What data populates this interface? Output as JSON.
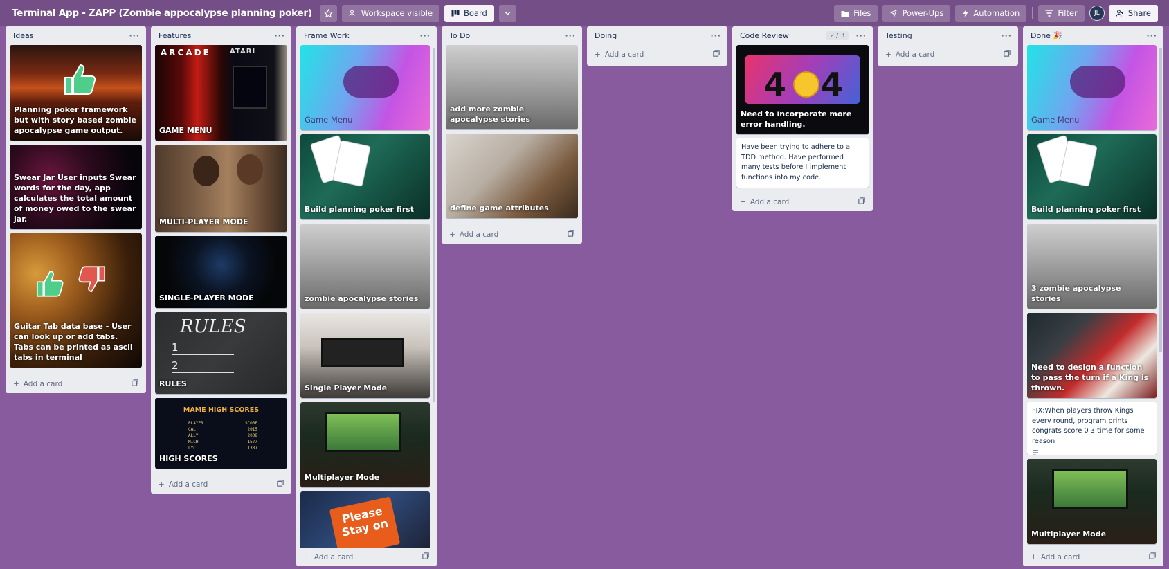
{
  "header": {
    "board_title": "Terminal App - ZAPP (Zombie appocalypse planning poker)",
    "workspace_visible": "Workspace visible",
    "board_label": "Board",
    "files": "Files",
    "powerups": "Power-Ups",
    "automation": "Automation",
    "filter": "Filter",
    "avatar_initials": "JL",
    "share": "Share"
  },
  "add_card": "Add a card",
  "lists": {
    "ideas": {
      "title": "Ideas",
      "cards": [
        "Planning poker framework but with story based zombie apocalypse game output.",
        "Swear Jar User inputs Swear words for the day, app calculates the total amount of money owed to the swear jar.",
        "Guitar Tab data base - User can look up or add tabs. Tabs can be printed as ascii tabs in terminal"
      ]
    },
    "features": {
      "title": "Features",
      "cards": [
        "GAME MENU",
        "MULTI-PLAYER MODE",
        "SINGLE-PLAYER MODE",
        "RULES",
        "HIGH SCORES"
      ],
      "art": {
        "arcade": "ARCADE",
        "atari": "ATARI",
        "rules_heading": "RULES",
        "rule1": "1",
        "rule2": "2",
        "mame": "MAME HIGH SCORES",
        "hs_cols": [
          "PLAYER",
          "SCORE"
        ],
        "hs_rows": [
          [
            "CAL",
            "2015"
          ],
          [
            "ALLY",
            "2008"
          ],
          [
            "MICH",
            "1577"
          ],
          [
            "LYC",
            "1337"
          ]
        ]
      }
    },
    "framework": {
      "title": "Frame Work",
      "cards": [
        "Game Menu",
        "Build planning poker first",
        "zombie apocalypse stories",
        "Single Player Mode",
        "Multiplayer Mode"
      ],
      "please_text": "Please Stay on"
    },
    "todo": {
      "title": "To Do",
      "cards": [
        "add more zombie apocalypse stories",
        "define game attributes"
      ]
    },
    "doing": {
      "title": "Doing"
    },
    "code_review": {
      "title": "Code Review",
      "badge": "2 / 3",
      "error_card": "Need to incorporate more error handling.",
      "art_404": "4",
      "art_404b": "4",
      "note": "Have been trying to adhere to a TDD method. Have performed many tests before I implement functions into my code."
    },
    "testing": {
      "title": "Testing"
    },
    "done": {
      "title": "Done 🎉",
      "cards": [
        "Game Menu",
        "Build planning poker first",
        "3 zombie apocalypse stories",
        "Need to design a function to pass the turn if a King is thrown."
      ],
      "note": "FIX:When players throw Kings every round, program prints congrats score 0 3 time for some reason",
      "last_card": "Multiplayer Mode"
    }
  },
  "colors": {
    "board_bg": "#875b9e",
    "list_bg": "#ebecf0"
  }
}
